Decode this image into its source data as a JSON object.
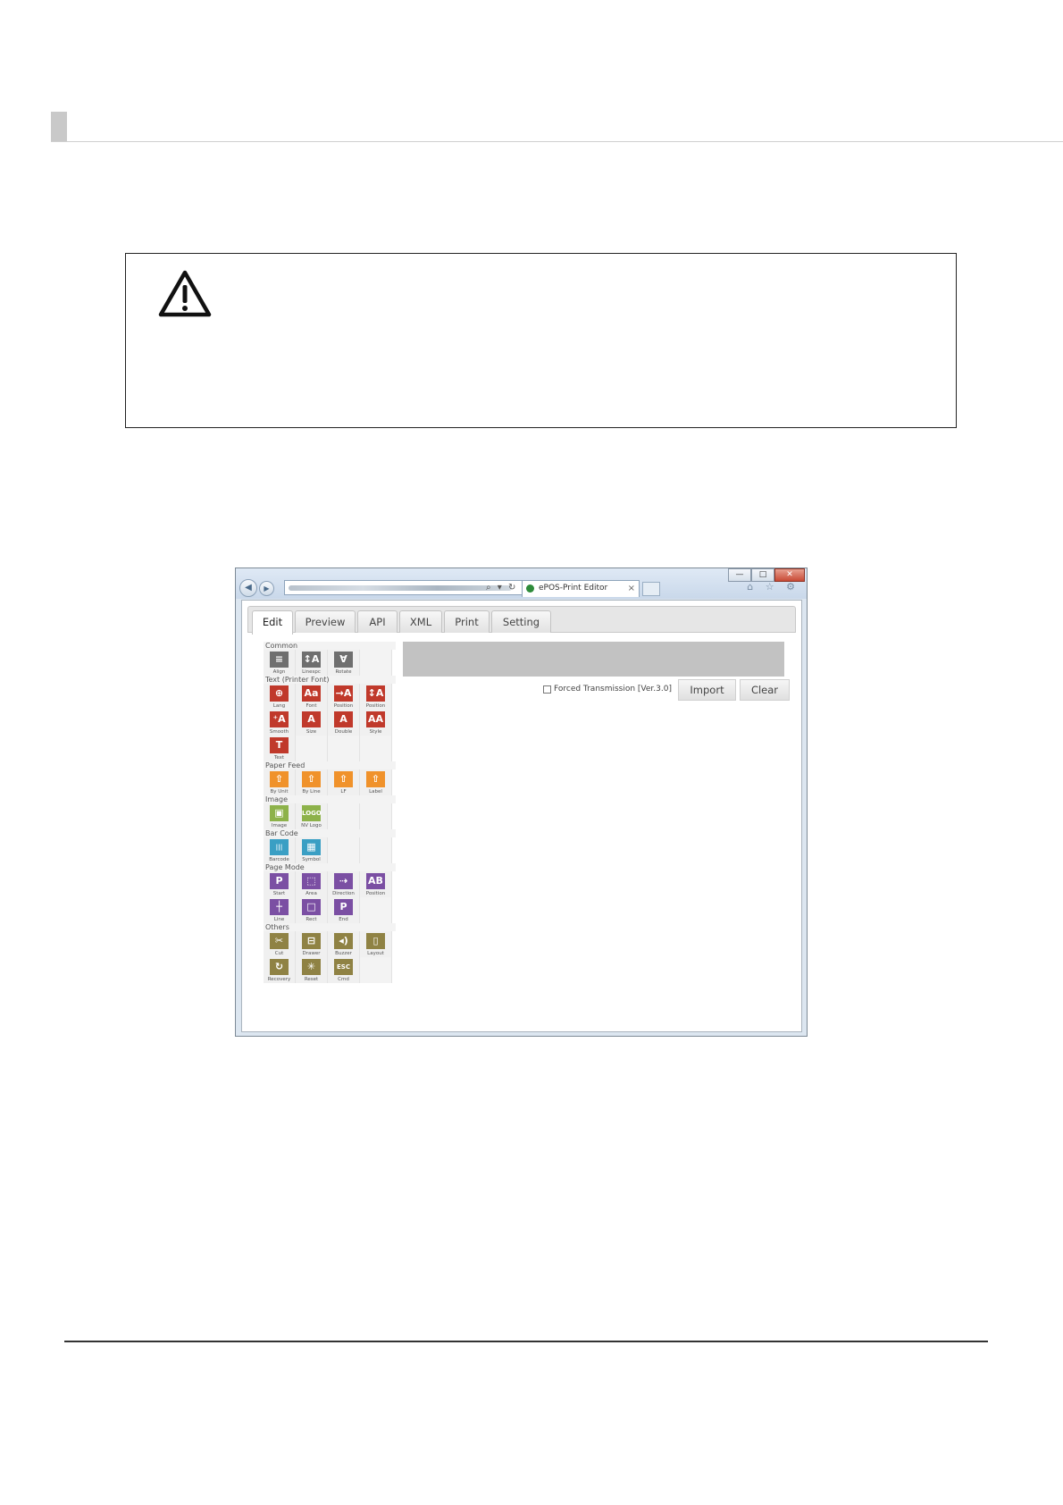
{
  "browser": {
    "tab_title": "ePOS-Print Editor",
    "tab_close": "×",
    "address_icons": "⌕ ▾ ↻ ✕",
    "window_buttons": {
      "minimize": "—",
      "maximize": "□",
      "close": "✕"
    },
    "nav": {
      "back": "◀",
      "forward": "▶"
    },
    "toolbar_icons": "⌂ ☆ ⚙"
  },
  "app": {
    "tabs": [
      {
        "label": "Edit",
        "active": true
      },
      {
        "label": "Preview"
      },
      {
        "label": "API"
      },
      {
        "label": "XML"
      },
      {
        "label": "Print"
      },
      {
        "label": "Setting"
      }
    ],
    "forced_transmission_label": "Forced Transmission [Ver.3.0]",
    "import_label": "Import",
    "clear_label": "Clear",
    "palette": [
      {
        "section": "Common",
        "rows": [
          [
            {
              "label": "Align",
              "glyph": "≡",
              "color": "gray",
              "icon": "align-icon"
            },
            {
              "label": "Linespc",
              "glyph": "↕A",
              "color": "gray",
              "icon": "line-spacing-icon"
            },
            {
              "label": "Rotate",
              "glyph": "∀",
              "color": "gray",
              "icon": "rotate-icon"
            }
          ]
        ]
      },
      {
        "section": "Text (Printer Font)",
        "rows": [
          [
            {
              "label": "Lang",
              "glyph": "⊕",
              "color": "red",
              "icon": "language-icon"
            },
            {
              "label": "Font",
              "glyph": "Aa",
              "color": "red",
              "icon": "font-icon"
            },
            {
              "label": "Position",
              "glyph": "→A",
              "color": "red",
              "icon": "text-position-icon"
            },
            {
              "label": "Position",
              "glyph": "↕A",
              "color": "red",
              "icon": "vertical-position-icon"
            }
          ],
          [
            {
              "label": "Smooth",
              "glyph": "⁺A",
              "color": "red",
              "icon": "smooth-icon"
            },
            {
              "label": "Size",
              "glyph": "A",
              "color": "red",
              "icon": "size-icon"
            },
            {
              "label": "Double",
              "glyph": "A",
              "color": "red",
              "icon": "double-icon"
            },
            {
              "label": "Style",
              "glyph": "AA",
              "color": "red",
              "icon": "style-icon"
            }
          ],
          [
            {
              "label": "Text",
              "glyph": "T",
              "color": "red",
              "icon": "text-icon"
            }
          ]
        ]
      },
      {
        "section": "Paper Feed",
        "rows": [
          [
            {
              "label": "By Unit",
              "glyph": "⇧",
              "color": "orange",
              "icon": "feed-unit-icon"
            },
            {
              "label": "By Line",
              "glyph": "⇧",
              "color": "orange",
              "icon": "feed-line-icon"
            },
            {
              "label": "LF",
              "glyph": "⇧",
              "color": "orange",
              "icon": "line-feed-icon"
            },
            {
              "label": "Label",
              "glyph": "⇧",
              "color": "orange",
              "icon": "label-feed-icon"
            }
          ]
        ]
      },
      {
        "section": "Image",
        "rows": [
          [
            {
              "label": "Image",
              "glyph": "▣",
              "color": "green",
              "icon": "image-icon"
            },
            {
              "label": "NV Logo",
              "glyph": "LOGO",
              "color": "green",
              "icon": "nv-logo-icon"
            }
          ]
        ]
      },
      {
        "section": "Bar Code",
        "rows": [
          [
            {
              "label": "Barcode",
              "glyph": "|||",
              "color": "blue",
              "icon": "barcode-icon"
            },
            {
              "label": "Symbol",
              "glyph": "▦",
              "color": "blue",
              "icon": "symbol-icon"
            }
          ]
        ]
      },
      {
        "section": "Page Mode",
        "rows": [
          [
            {
              "label": "Start",
              "glyph": "P",
              "color": "purple",
              "icon": "page-start-icon"
            },
            {
              "label": "Area",
              "glyph": "⬚",
              "color": "purple",
              "icon": "area-icon"
            },
            {
              "label": "Direction",
              "glyph": "⇢",
              "color": "purple",
              "icon": "direction-icon"
            },
            {
              "label": "Position",
              "glyph": "AB",
              "color": "purple",
              "icon": "page-position-icon"
            }
          ],
          [
            {
              "label": "Line",
              "glyph": "┼",
              "color": "purple",
              "icon": "line-icon"
            },
            {
              "label": "Rect",
              "glyph": "□",
              "color": "purple",
              "icon": "rect-icon"
            },
            {
              "label": "End",
              "glyph": "P",
              "color": "purple",
              "icon": "page-end-icon"
            }
          ]
        ]
      },
      {
        "section": "Others",
        "rows": [
          [
            {
              "label": "Cut",
              "glyph": "✂",
              "color": "olive",
              "icon": "cut-icon"
            },
            {
              "label": "Drawer",
              "glyph": "⊟",
              "color": "olive",
              "icon": "drawer-icon"
            },
            {
              "label": "Buzzer",
              "glyph": "◂)",
              "color": "olive",
              "icon": "buzzer-icon"
            },
            {
              "label": "Layout",
              "glyph": "▯",
              "color": "olive",
              "icon": "layout-icon"
            }
          ],
          [
            {
              "label": "Recovery",
              "glyph": "↻",
              "color": "olive",
              "icon": "recovery-icon"
            },
            {
              "label": "Reset",
              "glyph": "✳",
              "color": "olive",
              "icon": "reset-icon"
            },
            {
              "label": "Cmd",
              "glyph": "ESC",
              "color": "olive",
              "icon": "command-icon"
            }
          ]
        ]
      }
    ]
  },
  "colors": {
    "gray": "#6f6f6f",
    "red": "#c0392b",
    "orange": "#f0922b",
    "green": "#8db24a",
    "blue": "#3a9fc4",
    "purple": "#7b4fa3",
    "olive": "#8f8244"
  }
}
